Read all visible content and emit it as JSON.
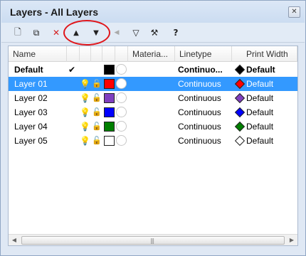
{
  "window": {
    "title": "Layers - All Layers",
    "close_glyph": "✕"
  },
  "toolbar": [
    {
      "name": "new-layer-icon",
      "glyph": "🗋"
    },
    {
      "name": "new-sublayer-icon",
      "glyph": "⧉"
    },
    {
      "name": "delete-layer-icon",
      "glyph": "✕"
    },
    {
      "name": "move-up-icon",
      "glyph": "▲"
    },
    {
      "name": "move-down-icon",
      "glyph": "▼"
    },
    {
      "name": "move-to-parent-icon",
      "glyph": "◀"
    },
    {
      "name": "filter-icon",
      "glyph": "▽"
    },
    {
      "name": "tools-icon",
      "glyph": "⚒"
    },
    {
      "name": "help-icon",
      "glyph": "?"
    }
  ],
  "columns": [
    "Name",
    "Materia...",
    "Linetype",
    "Print Width"
  ],
  "layers": [
    {
      "name": "Default",
      "current": true,
      "check": "✔",
      "color": "#000000",
      "linetype": "Continuo...",
      "print_color": "#000000",
      "print_width": "Default",
      "bold": true,
      "selected": false,
      "show_icons": false
    },
    {
      "name": "Layer 01",
      "current": false,
      "check": "",
      "color": "#ff0000",
      "linetype": "Continuous",
      "print_color": "#ff0000",
      "print_width": "Default",
      "bold": false,
      "selected": true,
      "show_icons": true
    },
    {
      "name": "Layer 02",
      "current": false,
      "check": "",
      "color": "#7f3fbf",
      "linetype": "Continuous",
      "print_color": "#7f3fbf",
      "print_width": "Default",
      "bold": false,
      "selected": false,
      "show_icons": true
    },
    {
      "name": "Layer 03",
      "current": false,
      "check": "",
      "color": "#0000ff",
      "linetype": "Continuous",
      "print_color": "#0000ff",
      "print_width": "Default",
      "bold": false,
      "selected": false,
      "show_icons": true
    },
    {
      "name": "Layer 04",
      "current": false,
      "check": "",
      "color": "#007f00",
      "linetype": "Continuous",
      "print_color": "#007f00",
      "print_width": "Default",
      "bold": false,
      "selected": false,
      "show_icons": true
    },
    {
      "name": "Layer 05",
      "current": false,
      "check": "",
      "color": "#ffffff",
      "linetype": "Continuous",
      "print_color": "#ffffff",
      "print_width": "Default",
      "bold": false,
      "selected": false,
      "show_icons": true
    }
  ],
  "icons": {
    "bulb": "💡",
    "lock": "🔓"
  },
  "scrollbar": {
    "left": "◀",
    "right": "▶",
    "grip": "|||"
  },
  "colors": {
    "selection": "#3399ff",
    "highlight_ring": "#e0161b"
  }
}
